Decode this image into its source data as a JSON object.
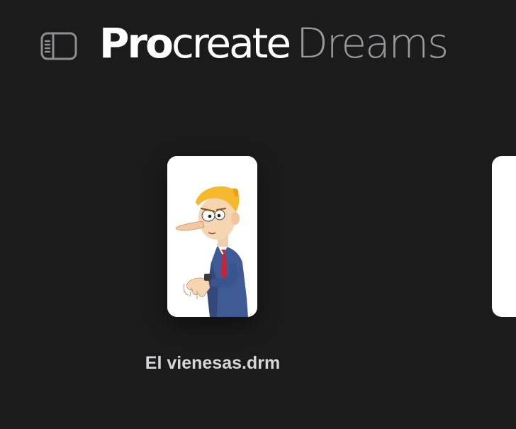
{
  "header": {
    "sidebar_toggle_icon": "sidebar-toggle-icon",
    "logo": {
      "pro": "Pro",
      "create": "create",
      "dreams": "Dreams"
    }
  },
  "gallery": {
    "documents": [
      {
        "title": "El vienesas.drm",
        "thumbnail": "cartoon-man-checking-watch"
      },
      {
        "title": "",
        "thumbnail": "partially-visible-document"
      }
    ]
  },
  "colors": {
    "background": "#1b1b1c",
    "logo_primary": "#ffffff",
    "logo_secondary": "#9a9a9c",
    "doc_title": "#d6d6d8",
    "card": "#ffffff"
  }
}
